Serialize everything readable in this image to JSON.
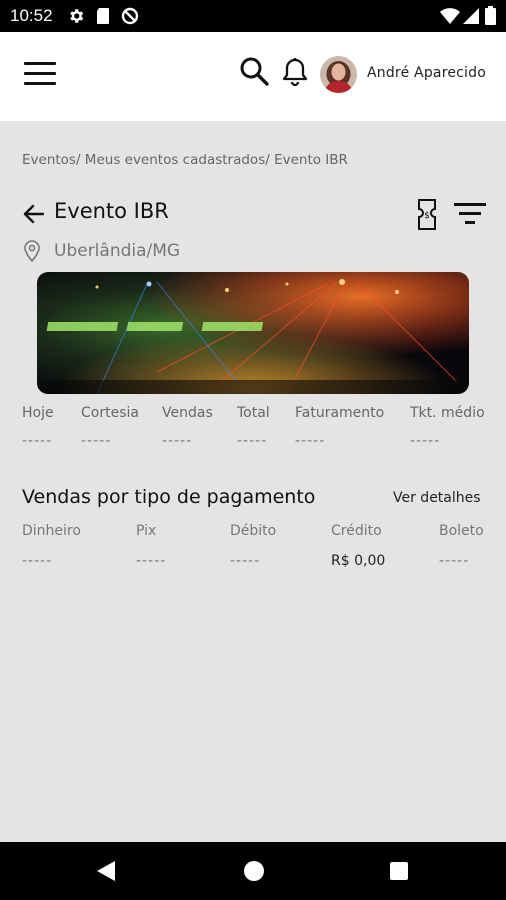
{
  "status": {
    "time": "10:52"
  },
  "header": {
    "user_name": "André Aparecido"
  },
  "breadcrumb": "Eventos/ Meus eventos cadastrados/ Evento IBR",
  "event": {
    "title": "Evento IBR",
    "location": "Uberlândia/MG"
  },
  "stats": [
    {
      "label": "Hoje",
      "value": "-----"
    },
    {
      "label": "Cortesia",
      "value": "-----"
    },
    {
      "label": "Vendas",
      "value": "-----"
    },
    {
      "label": "Total",
      "value": "-----"
    },
    {
      "label": "Faturamento",
      "value": "-----"
    },
    {
      "label": "Tkt. médio",
      "value": "-----"
    }
  ],
  "payments": {
    "title": "Vendas por tipo de pagamento",
    "details_link": "Ver detalhes",
    "items": [
      {
        "label": "Dinheiro",
        "value": "-----"
      },
      {
        "label": "Pix",
        "value": "-----"
      },
      {
        "label": "Débito",
        "value": "-----"
      },
      {
        "label": "Crédito",
        "value": "R$ 0,00"
      },
      {
        "label": "Boleto",
        "value": "-----"
      }
    ]
  },
  "icons": {
    "status": [
      "gear-icon",
      "sim-icon",
      "no-sync-icon",
      "wifi-icon",
      "signal-icon",
      "battery-icon"
    ],
    "header": [
      "menu-icon",
      "search-icon",
      "bell-icon"
    ],
    "event": [
      "arrow-back-icon",
      "ticket-icon",
      "filter-icon",
      "location-pin-icon"
    ]
  },
  "colors": {
    "background": "#e4e4e4",
    "appbar": "#ffffff",
    "system_bars": "#000000"
  }
}
